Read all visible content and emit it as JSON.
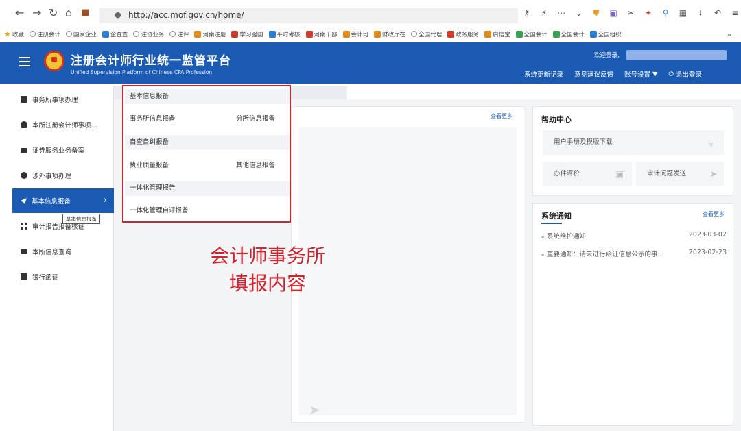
{
  "browser": {
    "url": "http://acc.mof.gov.cn/home/",
    "bookmarks": [
      "收藏",
      "注册会计",
      "国家企业",
      "企查查",
      "注协业务",
      "注评",
      "河南注册",
      "学习强国",
      "平时考核",
      "河南干部",
      "会计司",
      "财政厅在",
      "全国代理",
      "政务服务",
      "启信宝",
      "全国会计",
      "全国会计",
      "全国组织"
    ]
  },
  "header": {
    "title": "注册会计师行业统一监管平台",
    "subtitle": "Unified Supervision Platform of Chinese CPA Profession",
    "welcome": "欢迎登录,",
    "links": {
      "update_log": "系统更新记录",
      "feedback": "意见建议反馈",
      "account_settings": "账号设置",
      "logout": "退出登录"
    }
  },
  "sidebar": {
    "items": [
      {
        "label": "事务所事项办理"
      },
      {
        "label": "本所注册会计师事项..."
      },
      {
        "label": "证券服务业务备案"
      },
      {
        "label": "涉外事项办理"
      },
      {
        "label": "基本信息报备"
      },
      {
        "label": "审计报告报备核证"
      },
      {
        "label": "本所信息查询"
      },
      {
        "label": "银行函证"
      }
    ],
    "tooltip": "基本信息报备"
  },
  "flyout": {
    "groups": [
      {
        "title": "基本信息报备",
        "links": [
          "事务所信息报备",
          "分所信息报备"
        ]
      },
      {
        "title": "自查自纠报备",
        "links": [
          "执业质量报备",
          "其他信息报备"
        ]
      },
      {
        "title": "一体化管理报告",
        "links": [
          "一体化管理自评报备"
        ]
      }
    ]
  },
  "annotation": {
    "line1": "会计师事务所",
    "line2": "填报内容"
  },
  "main_card": {
    "view_more": "查看更多"
  },
  "help_center": {
    "title": "帮助中心",
    "manual_download": "用户手册及模版下载",
    "evaluation": "办件评价",
    "audit_issue": "审计问题发送"
  },
  "notices": {
    "title": "系统通知",
    "view_more": "查看更多",
    "items": [
      {
        "text": "系统维护通知",
        "date": "2023-03-02"
      },
      {
        "text": "重要通知：请未进行函证信息公示的事...",
        "date": "2023-02-23"
      }
    ]
  }
}
